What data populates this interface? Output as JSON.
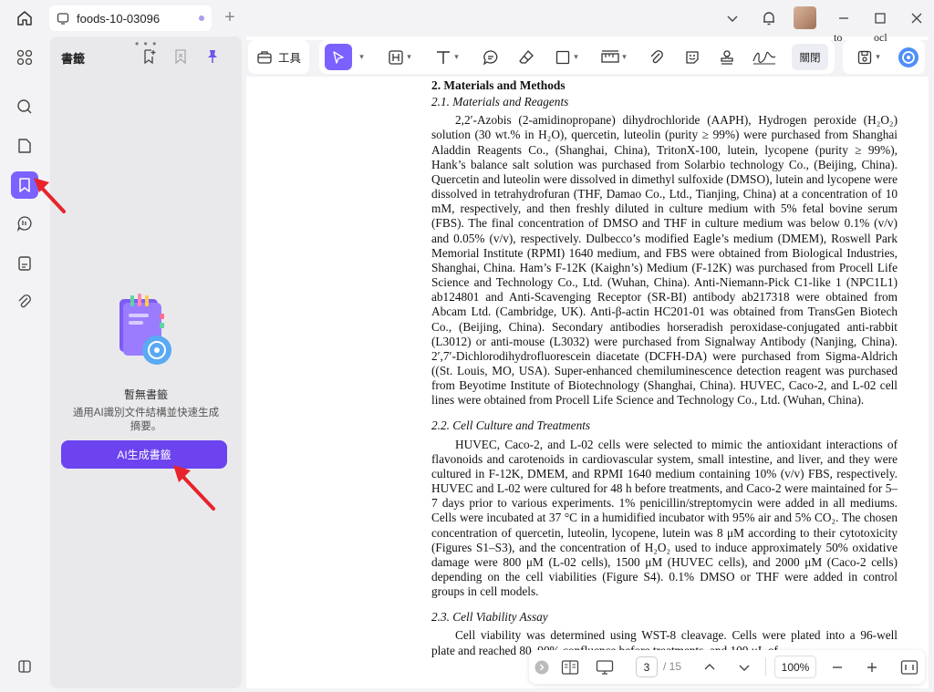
{
  "window": {
    "tab_title": "foods-10-03096",
    "new_tab": "+"
  },
  "sidebar": {
    "items": [
      "apps-icon",
      "search-icon",
      "pages-icon",
      "bookmark-icon",
      "ai-chat-icon",
      "form-icon",
      "attachment-icon"
    ],
    "active": "bookmark-icon"
  },
  "bookmark_panel": {
    "title": "書籤",
    "grip": "• • •",
    "empty_title": "暫無書籤",
    "empty_desc": "通用AI識別文件結構並快速生成摘要。",
    "ai_button": "AI生成書籤"
  },
  "toolbar": {
    "tools_label": "工具",
    "close_label": "關閉"
  },
  "document": {
    "section_heading": "2. Materials and Methods",
    "sub1": "2.1. Materials and Reagents",
    "p1": "2,2′-Azobis (2-amidinopropane) dihydrochloride (AAPH), Hydrogen peroxide (H₂O₂) solution (30 wt.% in H₂O), quercetin, luteolin (purity ≥ 99%) were purchased from Shanghai Aladdin Reagents Co., (Shanghai, China), TritonX-100, lutein, lycopene (purity ≥ 99%), Hank’s balance salt solution was purchased from Solarbio technology Co., (Beijing, China). Quercetin and luteolin were dissolved in dimethyl sulfoxide (DMSO), lutein and lycopene were dissolved in tetrahydrofuran (THF, Damao Co., Ltd., Tianjing, China) at a concentration of 10 mM, respectively, and then freshly diluted in culture medium with 5% fetal bovine serum (FBS). The final concentration of DMSO and THF in culture medium was below 0.1% (v/v) and 0.05% (v/v), respectively. Dulbecco’s modified Eagle’s medium (DMEM), Roswell Park Memorial Institute (RPMI) 1640 medium, and FBS were obtained from Biological Industries, Shanghai, China. Ham’s F-12K (Kaighn’s) Medium (F-12K) was purchased from Procell Life Science and Technology Co., Ltd. (Wuhan, China). Anti-Niemann-Pick C1-like 1 (NPC1L1) ab124801 and Anti-Scavenging Receptor (SR-BI) antibody ab217318 were obtained from Abcam Ltd. (Cambridge, UK). Anti-β-actin HC201-01 was obtained from TransGen Biotech Co., (Beijing, China). Secondary antibodies horseradish peroxidase-conjugated anti-rabbit (L3012) or anti-mouse (L3032) were purchased from Signalway Antibody (Nanjing, China). 2′,7′-Dichlorodihydrofluorescein diacetate (DCFH-DA) were purchased from Sigma-Aldrich ((St. Louis, MO, USA). Super-enhanced chemiluminescence detection reagent was purchased from Beyotime Institute of Biotechnology (Shanghai, China). HUVEC, Caco-2, and L-02 cell lines were obtained from Procell Life Science and Technology Co., Ltd. (Wuhan, China).",
    "sub2": "2.2. Cell Culture and Treatments",
    "p2": "HUVEC, Caco-2, and L-02 cells were selected to mimic the antioxidant interactions of flavonoids and carotenoids in cardiovascular system, small intestine, and liver, and they were cultured in F-12K, DMEM, and RPMI 1640 medium containing 10% (v/v) FBS, respectively. HUVEC and L-02 were cultured for 48 h before treatments, and Caco-2 were maintained for 5–7 days prior to various experiments. 1% penicillin/streptomycin were added in all mediums. Cells were incubated at 37 °C in a humidified incubator with 95% air and 5% CO₂. The chosen concentration of quercetin, luteolin, lycopene, lutein was 8 μM according to their cytotoxicity (Figures S1–S3), and the concentration of H₂O₂ used to induce approximately 50% oxidative damage were 800 μM (L-02 cells), 1500 μM (HUVEC cells), and 2000 μM (Caco-2 cells) depending on the cell viabilities (Figure S4). 0.1% DMSO or THF were added in control groups in cell models.",
    "sub3": "2.3. Cell Viability Assay",
    "p3": "Cell viability was determined using WST-8 cleavage. Cells were plated into a 96-well plate and reached 80–90% confluence before treatments, and 100 μL of",
    "top_fragment_1": "to",
    "top_fragment_2": "ocl"
  },
  "bottom_bar": {
    "page_current": "3",
    "page_total": "/ 15",
    "zoom": "100%"
  }
}
